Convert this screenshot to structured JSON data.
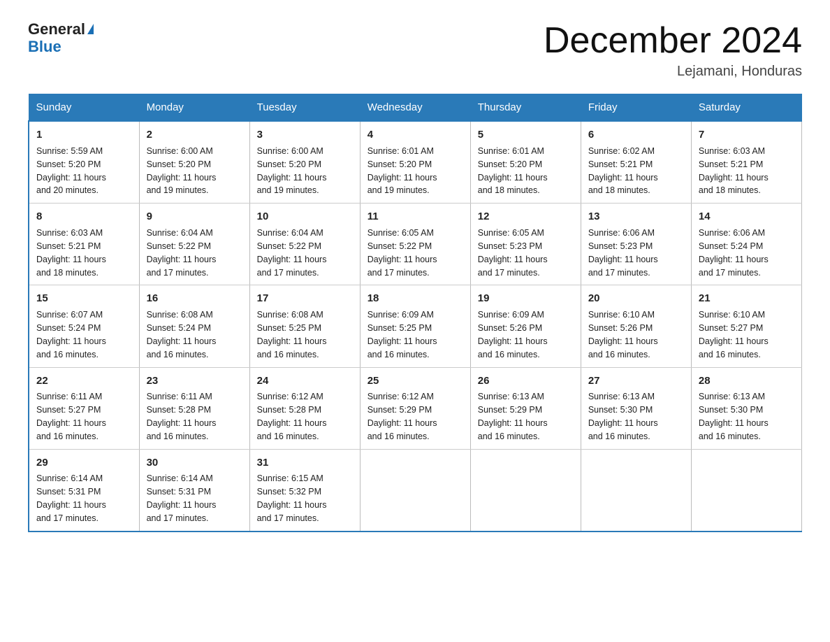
{
  "logo": {
    "general": "General",
    "blue": "Blue",
    "triangle": "▲"
  },
  "header": {
    "title": "December 2024",
    "subtitle": "Lejamani, Honduras"
  },
  "days_of_week": [
    "Sunday",
    "Monday",
    "Tuesday",
    "Wednesday",
    "Thursday",
    "Friday",
    "Saturday"
  ],
  "weeks": [
    [
      {
        "day": "1",
        "sunrise": "5:59 AM",
        "sunset": "5:20 PM",
        "daylight": "11 hours and 20 minutes."
      },
      {
        "day": "2",
        "sunrise": "6:00 AM",
        "sunset": "5:20 PM",
        "daylight": "11 hours and 19 minutes."
      },
      {
        "day": "3",
        "sunrise": "6:00 AM",
        "sunset": "5:20 PM",
        "daylight": "11 hours and 19 minutes."
      },
      {
        "day": "4",
        "sunrise": "6:01 AM",
        "sunset": "5:20 PM",
        "daylight": "11 hours and 19 minutes."
      },
      {
        "day": "5",
        "sunrise": "6:01 AM",
        "sunset": "5:20 PM",
        "daylight": "11 hours and 18 minutes."
      },
      {
        "day": "6",
        "sunrise": "6:02 AM",
        "sunset": "5:21 PM",
        "daylight": "11 hours and 18 minutes."
      },
      {
        "day": "7",
        "sunrise": "6:03 AM",
        "sunset": "5:21 PM",
        "daylight": "11 hours and 18 minutes."
      }
    ],
    [
      {
        "day": "8",
        "sunrise": "6:03 AM",
        "sunset": "5:21 PM",
        "daylight": "11 hours and 18 minutes."
      },
      {
        "day": "9",
        "sunrise": "6:04 AM",
        "sunset": "5:22 PM",
        "daylight": "11 hours and 17 minutes."
      },
      {
        "day": "10",
        "sunrise": "6:04 AM",
        "sunset": "5:22 PM",
        "daylight": "11 hours and 17 minutes."
      },
      {
        "day": "11",
        "sunrise": "6:05 AM",
        "sunset": "5:22 PM",
        "daylight": "11 hours and 17 minutes."
      },
      {
        "day": "12",
        "sunrise": "6:05 AM",
        "sunset": "5:23 PM",
        "daylight": "11 hours and 17 minutes."
      },
      {
        "day": "13",
        "sunrise": "6:06 AM",
        "sunset": "5:23 PM",
        "daylight": "11 hours and 17 minutes."
      },
      {
        "day": "14",
        "sunrise": "6:06 AM",
        "sunset": "5:24 PM",
        "daylight": "11 hours and 17 minutes."
      }
    ],
    [
      {
        "day": "15",
        "sunrise": "6:07 AM",
        "sunset": "5:24 PM",
        "daylight": "11 hours and 16 minutes."
      },
      {
        "day": "16",
        "sunrise": "6:08 AM",
        "sunset": "5:24 PM",
        "daylight": "11 hours and 16 minutes."
      },
      {
        "day": "17",
        "sunrise": "6:08 AM",
        "sunset": "5:25 PM",
        "daylight": "11 hours and 16 minutes."
      },
      {
        "day": "18",
        "sunrise": "6:09 AM",
        "sunset": "5:25 PM",
        "daylight": "11 hours and 16 minutes."
      },
      {
        "day": "19",
        "sunrise": "6:09 AM",
        "sunset": "5:26 PM",
        "daylight": "11 hours and 16 minutes."
      },
      {
        "day": "20",
        "sunrise": "6:10 AM",
        "sunset": "5:26 PM",
        "daylight": "11 hours and 16 minutes."
      },
      {
        "day": "21",
        "sunrise": "6:10 AM",
        "sunset": "5:27 PM",
        "daylight": "11 hours and 16 minutes."
      }
    ],
    [
      {
        "day": "22",
        "sunrise": "6:11 AM",
        "sunset": "5:27 PM",
        "daylight": "11 hours and 16 minutes."
      },
      {
        "day": "23",
        "sunrise": "6:11 AM",
        "sunset": "5:28 PM",
        "daylight": "11 hours and 16 minutes."
      },
      {
        "day": "24",
        "sunrise": "6:12 AM",
        "sunset": "5:28 PM",
        "daylight": "11 hours and 16 minutes."
      },
      {
        "day": "25",
        "sunrise": "6:12 AM",
        "sunset": "5:29 PM",
        "daylight": "11 hours and 16 minutes."
      },
      {
        "day": "26",
        "sunrise": "6:13 AM",
        "sunset": "5:29 PM",
        "daylight": "11 hours and 16 minutes."
      },
      {
        "day": "27",
        "sunrise": "6:13 AM",
        "sunset": "5:30 PM",
        "daylight": "11 hours and 16 minutes."
      },
      {
        "day": "28",
        "sunrise": "6:13 AM",
        "sunset": "5:30 PM",
        "daylight": "11 hours and 16 minutes."
      }
    ],
    [
      {
        "day": "29",
        "sunrise": "6:14 AM",
        "sunset": "5:31 PM",
        "daylight": "11 hours and 17 minutes."
      },
      {
        "day": "30",
        "sunrise": "6:14 AM",
        "sunset": "5:31 PM",
        "daylight": "11 hours and 17 minutes."
      },
      {
        "day": "31",
        "sunrise": "6:15 AM",
        "sunset": "5:32 PM",
        "daylight": "11 hours and 17 minutes."
      },
      null,
      null,
      null,
      null
    ]
  ],
  "labels": {
    "sunrise": "Sunrise:",
    "sunset": "Sunset:",
    "daylight": "Daylight:"
  }
}
